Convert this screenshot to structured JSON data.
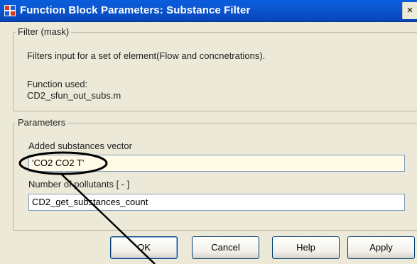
{
  "window": {
    "title": "Function Block Parameters: Substance Filter",
    "close_glyph": "×",
    "title_icon": "simulink-block-icon",
    "titlebar_color": "#0b57d0",
    "background": "#ece9d8"
  },
  "mask": {
    "group_title": "Filter (mask)",
    "description": "Filters input for a set of element(Flow and concnetrations).",
    "function_label": "Function used:",
    "function_name": "CD2_sfun_out_subs.m"
  },
  "parameters": {
    "group_title": "Parameters",
    "substances_label": "Added substances vector",
    "substances_value": "'CO2 CO2 T'",
    "pollutants_label": "Number of pollutants [ - ]",
    "pollutants_value": "CD2_get_substances_count"
  },
  "buttons": {
    "ok": "OK",
    "cancel": "Cancel",
    "help": "Help",
    "apply": "Apply"
  },
  "annotation": {
    "type": "ellipse-with-arrow",
    "color": "#000000"
  }
}
